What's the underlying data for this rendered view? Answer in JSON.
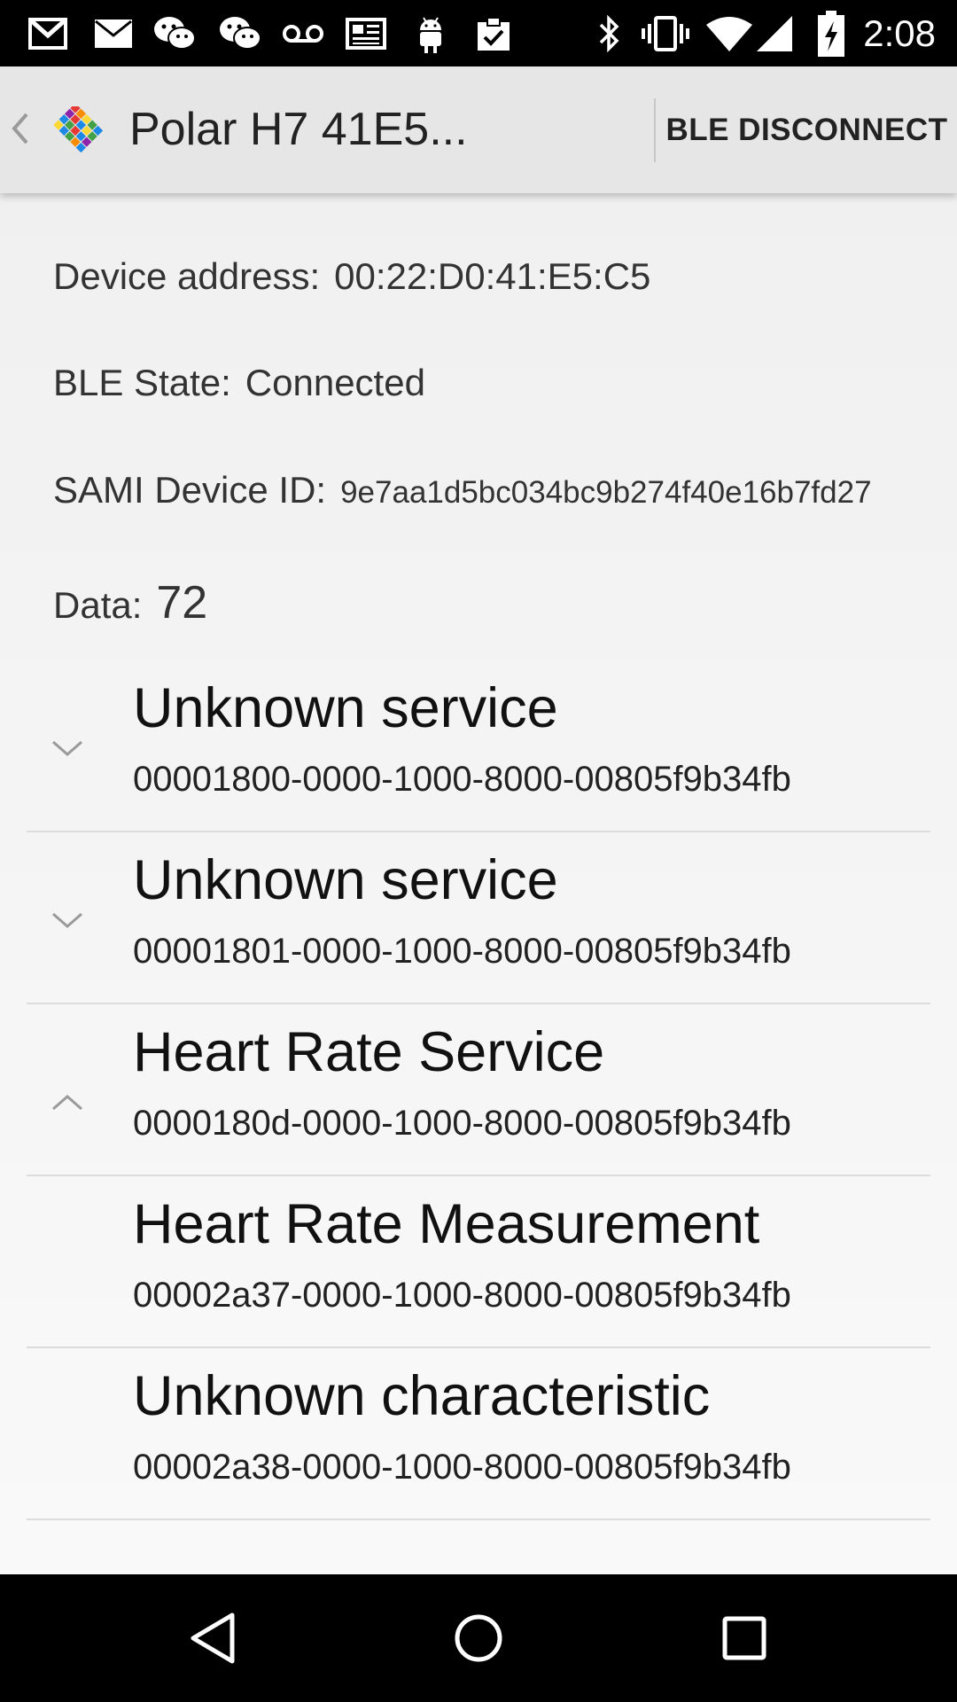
{
  "status_bar": {
    "time": "2:08",
    "icons": [
      "gmail-icon",
      "email-icon",
      "wechat-icon",
      "wechat-icon",
      "voicemail-icon",
      "news-icon",
      "android-icon",
      "clipboard-check-icon",
      "bluetooth-icon",
      "vibrate-icon",
      "wifi-icon",
      "cell-signal-icon",
      "battery-charging-icon"
    ]
  },
  "action_bar": {
    "title": "Polar H7 41E5...",
    "action_label": "BLE DISCONNECT"
  },
  "info": {
    "device_address": {
      "label": "Device address:",
      "value": "00:22:D0:41:E5:C5"
    },
    "ble_state": {
      "label": "BLE State:",
      "value": "Connected"
    },
    "sami_device_id": {
      "label": "SAMI Device ID:",
      "value": "9e7aa1d5bc034bc9b274f40e16b7fd27"
    },
    "data": {
      "label": "Data:",
      "value": "72"
    }
  },
  "services": [
    {
      "title": "Unknown service",
      "uuid": "00001800-0000-1000-8000-00805f9b34fb",
      "indicator": "chevron-down-icon"
    },
    {
      "title": "Unknown service",
      "uuid": "00001801-0000-1000-8000-00805f9b34fb",
      "indicator": "chevron-down-icon"
    },
    {
      "title": "Heart Rate Service",
      "uuid": "0000180d-0000-1000-8000-00805f9b34fb",
      "indicator": "chevron-up-icon"
    },
    {
      "title": "Heart Rate Measurement",
      "uuid": "00002a37-0000-1000-8000-00805f9b34fb"
    },
    {
      "title": "Unknown characteristic",
      "uuid": "00002a38-0000-1000-8000-00805f9b34fb"
    }
  ],
  "nav_bar": {
    "icons": [
      "back-icon",
      "home-icon",
      "recents-icon"
    ]
  },
  "colors": {
    "status_bar_bg": "#000000",
    "action_bar_bg": "#e6e6e6",
    "content_bg": "#f3f3f3",
    "divider": "#dcdcdc"
  }
}
